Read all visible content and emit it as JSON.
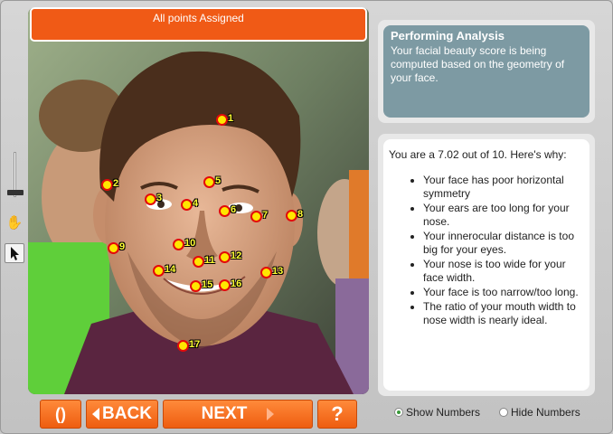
{
  "status": {
    "text": "All points Assigned"
  },
  "analysis": {
    "title": "Performing Analysis",
    "text": "Your facial beauty score is being computed based on the geometry of your face."
  },
  "result": {
    "score_text": "You are a 7.02 out of 10.  Here's why:",
    "reasons": [
      "Your face has poor horizontal symmetry",
      "Your ears are too long for your nose.",
      "Your innerocular distance is too big for your eyes.",
      "Your nose is too wide for your face width.",
      "Your face is too narrow/too long.",
      "The ratio of your mouth width to nose width is nearly ideal."
    ]
  },
  "points": [
    "1",
    "2",
    "3",
    "4",
    "5",
    "6",
    "7",
    "8",
    "9",
    "10",
    "11",
    "12",
    "13",
    "14",
    "15",
    "16",
    "17"
  ],
  "buttons": {
    "reset": "()",
    "back": "BACK",
    "next": "NEXT",
    "help": "?"
  },
  "options": {
    "show_numbers": "Show Numbers",
    "hide_numbers": "Hide Numbers",
    "selected": "Show Numbers"
  },
  "tools": {
    "zoom": "zoom-slider",
    "hand": "hand-icon",
    "pointer": "pointer-icon"
  },
  "colors": {
    "accent": "#f05a16",
    "panel": "#7d9aa3",
    "dot_fill": "#ffe600",
    "dot_stroke": "#e30a0a"
  }
}
